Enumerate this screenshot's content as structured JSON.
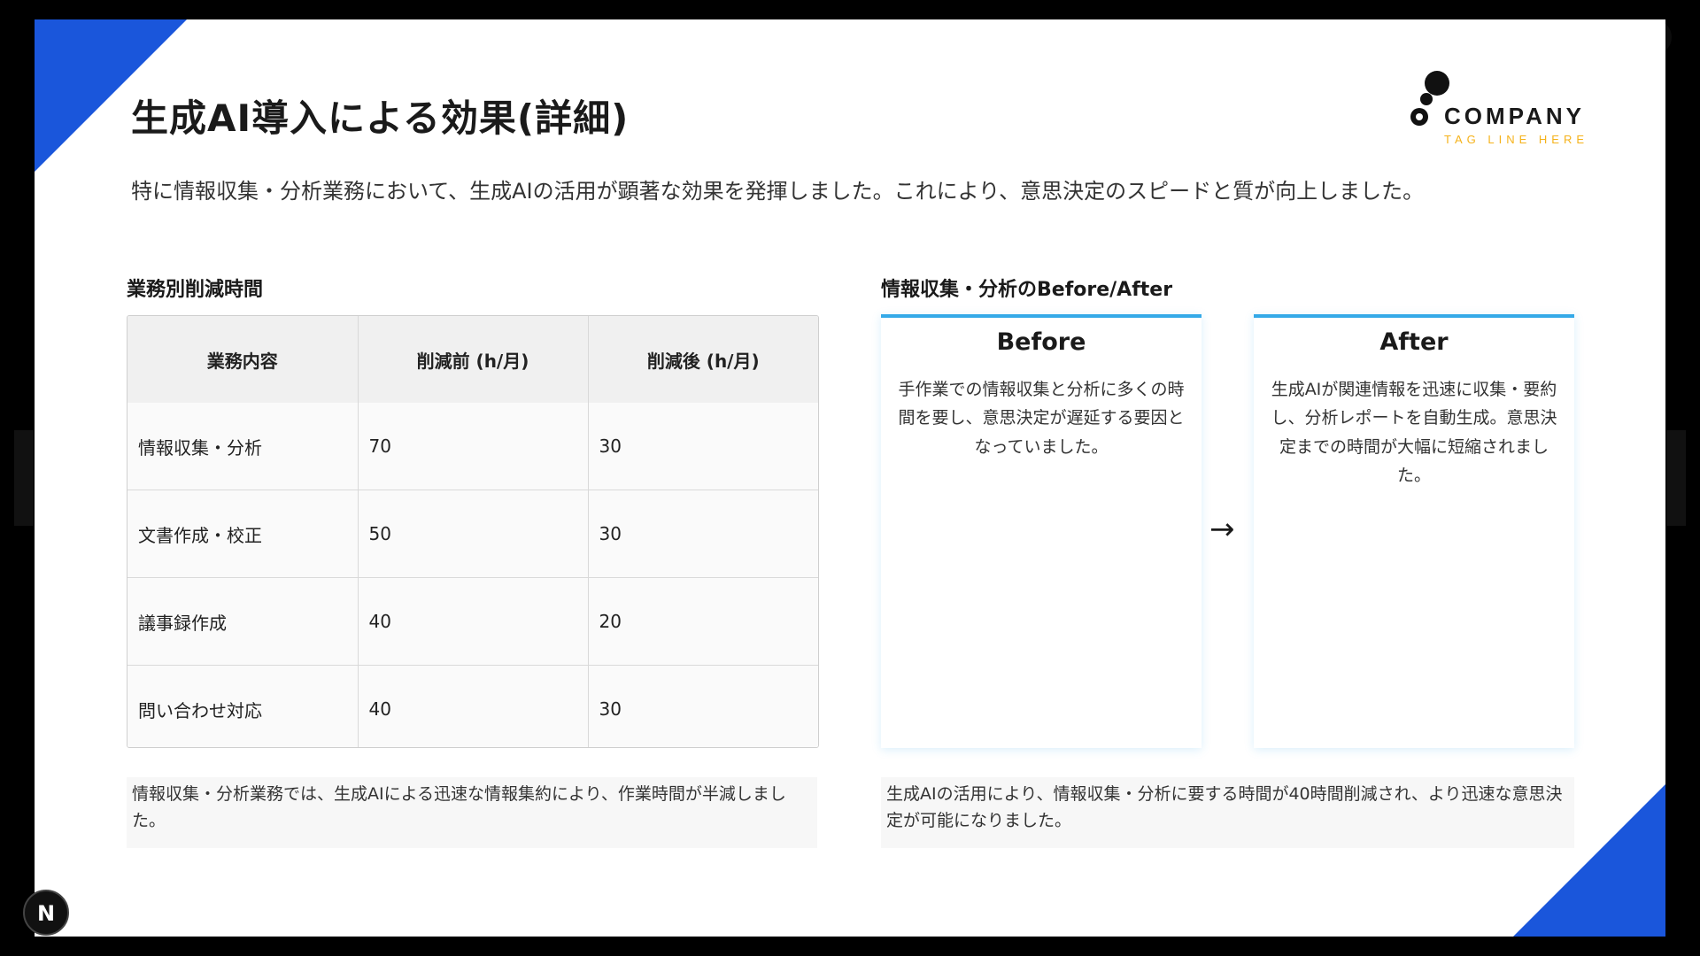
{
  "slide": {
    "title": "生成AI導入による効果(詳細)",
    "lead": "特に情報収集・分析業務において、生成AIの活用が顕著な効果を発揮しました。これにより、意思決定のスピードと質が向上しました。"
  },
  "logo": {
    "name": "COMPANY",
    "tagline": "TAG LINE HERE",
    "accent_color": "#f5b21a"
  },
  "table_section": {
    "title": "業務別削減時間",
    "headers": [
      "業務内容",
      "削減前 (h/月)",
      "削減後 (h/月)"
    ],
    "rows": [
      [
        "情報収集・分析",
        "70",
        "30"
      ],
      [
        "文書作成・校正",
        "50",
        "30"
      ],
      [
        "議事録作成",
        "40",
        "20"
      ],
      [
        "問い合わせ対応",
        "40",
        "30"
      ]
    ],
    "note": "情報収集・分析業務では、生成AIによる迅速な情報集約により、作業時間が半減しました。"
  },
  "compare_section": {
    "title": "情報収集・分析のBefore/After",
    "before": {
      "title": "Before",
      "body": "手作業での情報収集と分析に多くの時間を要し、意思決定が遅延する要因となっていました。"
    },
    "after": {
      "title": "After",
      "body": "生成AIが関連情報を迅速に収集・要約し、分析レポートを自動生成。意思決定までの時間が大幅に短縮されました。"
    },
    "arrow": "→",
    "note": "生成AIの活用により、情報収集・分析に要する時間が40時間削減され、より迅速な意思決定が可能になりました。"
  },
  "colors": {
    "accent_blue": "#1a56db",
    "card_border": "#34a9e8"
  },
  "overlay": {
    "badge": "N",
    "close": "✕"
  }
}
